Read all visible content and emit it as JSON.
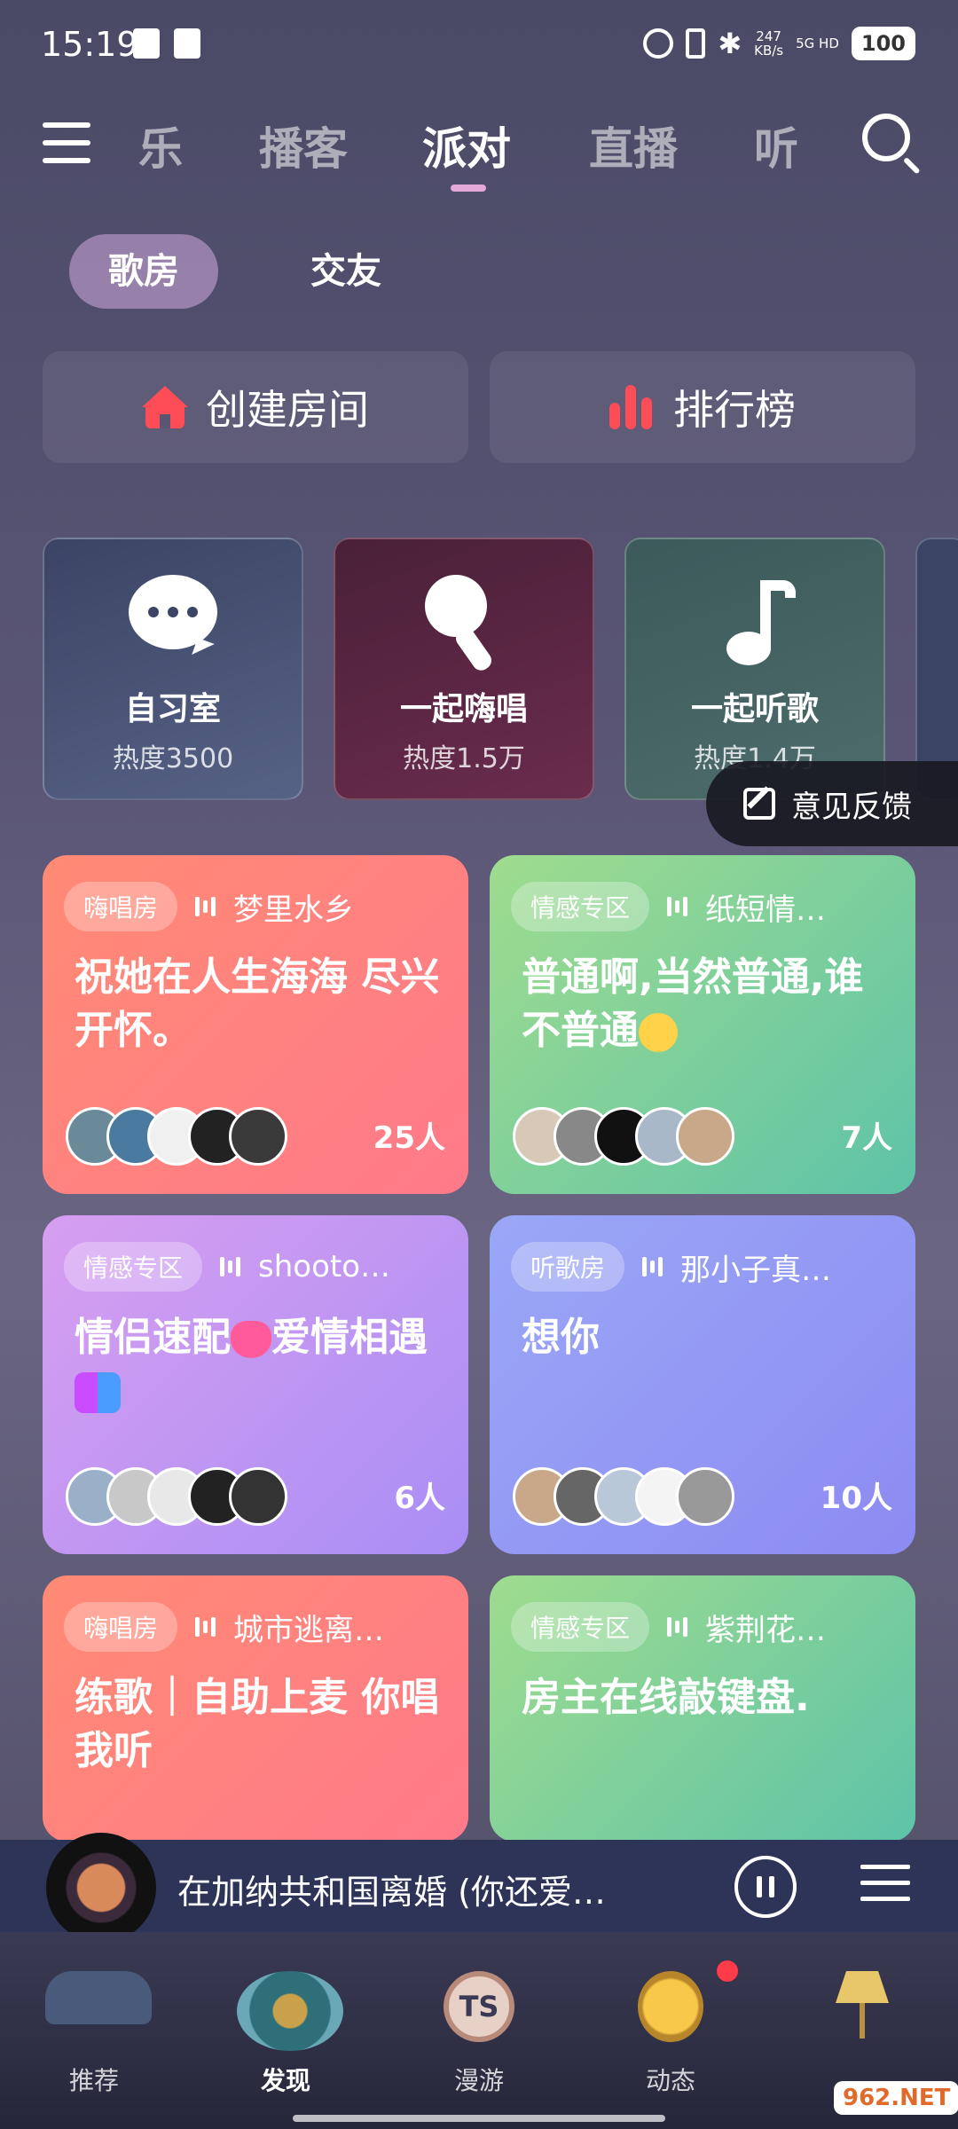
{
  "status_bar": {
    "time": "15:19",
    "network_speed": "247\nKB/s",
    "signal": "5G HD",
    "battery": "100",
    "icons": [
      "clipboard-check-icon",
      "alipay-icon",
      "alarm-icon",
      "vibrate-icon",
      "bluetooth-icon",
      "signal-icon",
      "battery-icon"
    ]
  },
  "top_nav": {
    "tabs": [
      {
        "label": "乐",
        "active": false
      },
      {
        "label": "播客",
        "active": false
      },
      {
        "label": "派对",
        "active": true
      },
      {
        "label": "直播",
        "active": false
      },
      {
        "label": "听",
        "active": false
      }
    ],
    "accent_color": "#e4a9d8"
  },
  "sub_tabs": [
    {
      "label": "歌房",
      "active": true
    },
    {
      "label": "交友",
      "active": false
    }
  ],
  "actions": {
    "create_room": "创建房间",
    "ranking": "排行榜"
  },
  "categories": [
    {
      "title": "自习室",
      "heat": "热度3500",
      "icon": "chat-bubble-icon"
    },
    {
      "title": "一起嗨唱",
      "heat": "热度1.5万",
      "icon": "microphone-icon"
    },
    {
      "title": "一起听歌",
      "heat": "热度1.4万",
      "icon": "music-note-icon"
    }
  ],
  "feedback": "意见反馈",
  "rooms": [
    {
      "tag": "嗨唱房",
      "host": "梦里水乡",
      "title": "祝她在人生海海 尽兴 开怀。",
      "count": "25人"
    },
    {
      "tag": "情感专区",
      "host": "纸短情…",
      "title": "普通啊,当然普通,谁不普通",
      "count": "7人"
    },
    {
      "tag": "情感专区",
      "host": "shooto…",
      "title_a": "情侣速配",
      "title_b": "爱情相遇",
      "count": "6人"
    },
    {
      "tag": "听歌房",
      "host": "那小子真…",
      "title": "想你",
      "count": "10人"
    },
    {
      "tag": "嗨唱房",
      "host": "城市逃离…",
      "title": "练歌｜自助上麦 你唱我听",
      "count": ""
    },
    {
      "tag": "情感专区",
      "host": "紫荆花…",
      "title": "房主在线敲键盘.",
      "count": ""
    }
  ],
  "player": {
    "song": "在加纳共和国离婚 (你还爱…",
    "state": "playing"
  },
  "bottom_nav": [
    {
      "label": "推荐",
      "active": false
    },
    {
      "label": "发现",
      "active": true
    },
    {
      "label": "漫游",
      "active": false,
      "badge_text": "TS"
    },
    {
      "label": "动态",
      "active": false
    },
    {
      "label": "",
      "active": false
    }
  ],
  "watermark": "962.NET"
}
